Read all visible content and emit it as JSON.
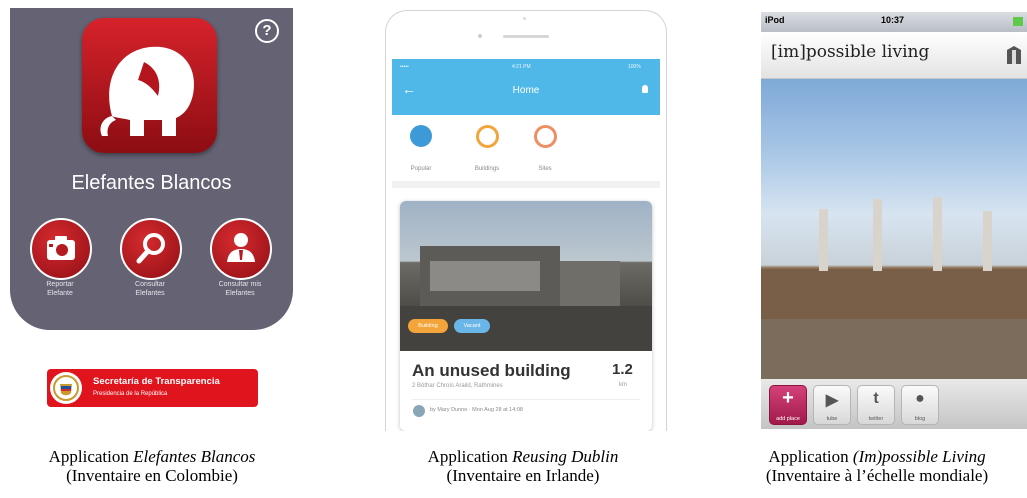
{
  "panel1": {
    "help_glyph": "?",
    "app_title": "Elefantes Blancos",
    "buttons": [
      {
        "label_line1": "Reportar",
        "label_line2": "Elefante",
        "icon": "camera-icon"
      },
      {
        "label_line1": "Consultar",
        "label_line2": "Elefantes",
        "icon": "magnifier-icon"
      },
      {
        "label_line1": "Consultar mis",
        "label_line2": "Elefantes",
        "icon": "person-icon"
      }
    ],
    "gov_banner_title": "Secretaría de Transparencia",
    "gov_banner_subtitle": "Presidencia de la República",
    "colors": {
      "background": "#646273",
      "accent": "#c3161d"
    }
  },
  "panel2": {
    "status_left": "•••••",
    "status_time": "4:21 PM",
    "status_right": "100%",
    "nav_title": "Home",
    "back_glyph": "←",
    "categories": [
      {
        "label": "Popular",
        "icon": "drop-icon",
        "color": "#3e9ad6"
      },
      {
        "label": "Buildings",
        "icon": "building-icon",
        "color": "#f3a43a"
      },
      {
        "label": "Sites",
        "icon": "site-icon",
        "color": "#ef8e62"
      }
    ],
    "card": {
      "tag1": "Building",
      "tag2": "Vacant",
      "title": "An unused building",
      "address": "2 Bóthar Chroís Araild, Rathmines",
      "distance": "1.2",
      "distance_unit": "km",
      "byline": "by Mary Dunne · Mon Aug 28 at 14:08"
    },
    "colors": {
      "nav_bar": "#4fb8e8"
    }
  },
  "panel3": {
    "status_carrier": "iPod",
    "status_time": "10:37",
    "brand": "[im]possible living",
    "toolbar": [
      {
        "label": "add place",
        "glyph": "+"
      },
      {
        "label": "tube",
        "glyph": "▶"
      },
      {
        "label": "twitter",
        "glyph": "t"
      },
      {
        "label": "blog",
        "glyph": "●"
      }
    ],
    "colors": {
      "add_button": "#c0245a"
    }
  },
  "captions": [
    {
      "prefix": "Application ",
      "app": "Elefantes Blancos",
      "line2": "(Inventaire en Colombie)"
    },
    {
      "prefix": "Application ",
      "app": "Reusing Dublin",
      "line2": "(Inventaire en Irlande)"
    },
    {
      "prefix": "Application ",
      "app": "(Im)possible Living",
      "line2": "(Inventaire à l’échelle mondiale)"
    }
  ]
}
